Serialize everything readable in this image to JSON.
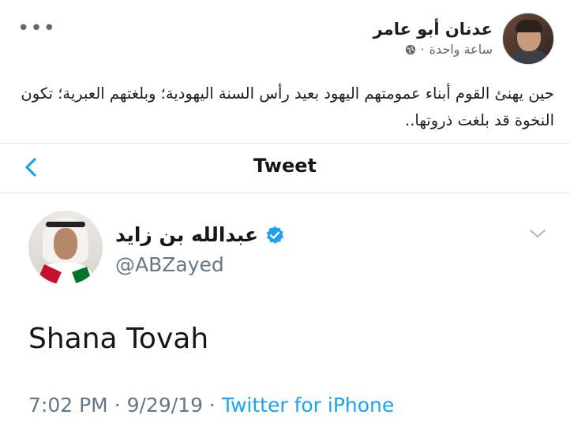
{
  "facebook_post": {
    "author": "عدنان أبو عامر",
    "time": "ساعة واحدة",
    "separator": "·",
    "text": "حين يهنئ القوم أبناء عمومتهم اليهود بعيد رأس السنة اليهودية؛ وبلغتهم العبرية؛ تكون النخوة قد بلغت ذروتها..",
    "more_label": "•••"
  },
  "twitter": {
    "nav_title": "Tweet",
    "author_name": "عبدالله بن زايد",
    "handle": "@ABZayed",
    "tweet_text": "Shana Tovah",
    "time": "7:02 PM",
    "date": "9/29/19",
    "dot": "·",
    "source": "Twitter for iPhone"
  },
  "colors": {
    "twitter_blue": "#1da1f2",
    "secondary_text": "#657786"
  }
}
